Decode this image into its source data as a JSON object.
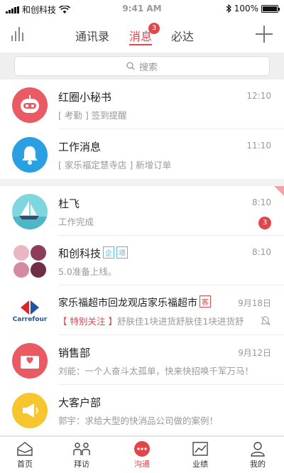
{
  "status_bar": {
    "carrier": "和创科技",
    "time": "9:41 AM",
    "battery": "100%"
  },
  "header": {
    "tabs": [
      {
        "label": "通讯录"
      },
      {
        "label": "消息",
        "badge": "3"
      },
      {
        "label": "必达"
      }
    ]
  },
  "search": {
    "placeholder": "搜索"
  },
  "system": [
    {
      "title": "红圈小秘书",
      "subtitle": "[ 考勤 ] 签到提醒",
      "time": "12:10"
    },
    {
      "title": "工作消息",
      "subtitle": "[ 家乐福定慧寺店 ] 新增订单",
      "time": "11:10"
    }
  ],
  "chats": [
    {
      "title": "杜飞",
      "subtitle": "工作完成",
      "time": "8:10",
      "badge": "3"
    },
    {
      "title": "和创科技",
      "tags": [
        "企",
        "项"
      ],
      "subtitle": "5.0准备上线。",
      "time": "8:10"
    },
    {
      "title": "家乐福超市回龙观店家乐福超市",
      "tag": "客",
      "special": "【 特别关注 】",
      "subtitle": "舒肤佳1块进货舒肤佳1块进货舒",
      "time": "9月18日",
      "logo_text": "Carrefour"
    },
    {
      "title": "销售部",
      "subtitle": "刘能：一个人奋斗太孤单，快来快招唤千军万马！",
      "time": "9月12日"
    },
    {
      "title": "大客户部",
      "subtitle": "郭宇：求给大型的快消品公司做的案例！",
      "time": ""
    }
  ],
  "bottom_nav": [
    {
      "label": "首页"
    },
    {
      "label": "拜访"
    },
    {
      "label": "沟通"
    },
    {
      "label": "业绩"
    },
    {
      "label": "我的"
    }
  ],
  "colors": {
    "accent": "#e0474b",
    "blue": "#2a9fe2",
    "yellow": "#f7c52e"
  }
}
